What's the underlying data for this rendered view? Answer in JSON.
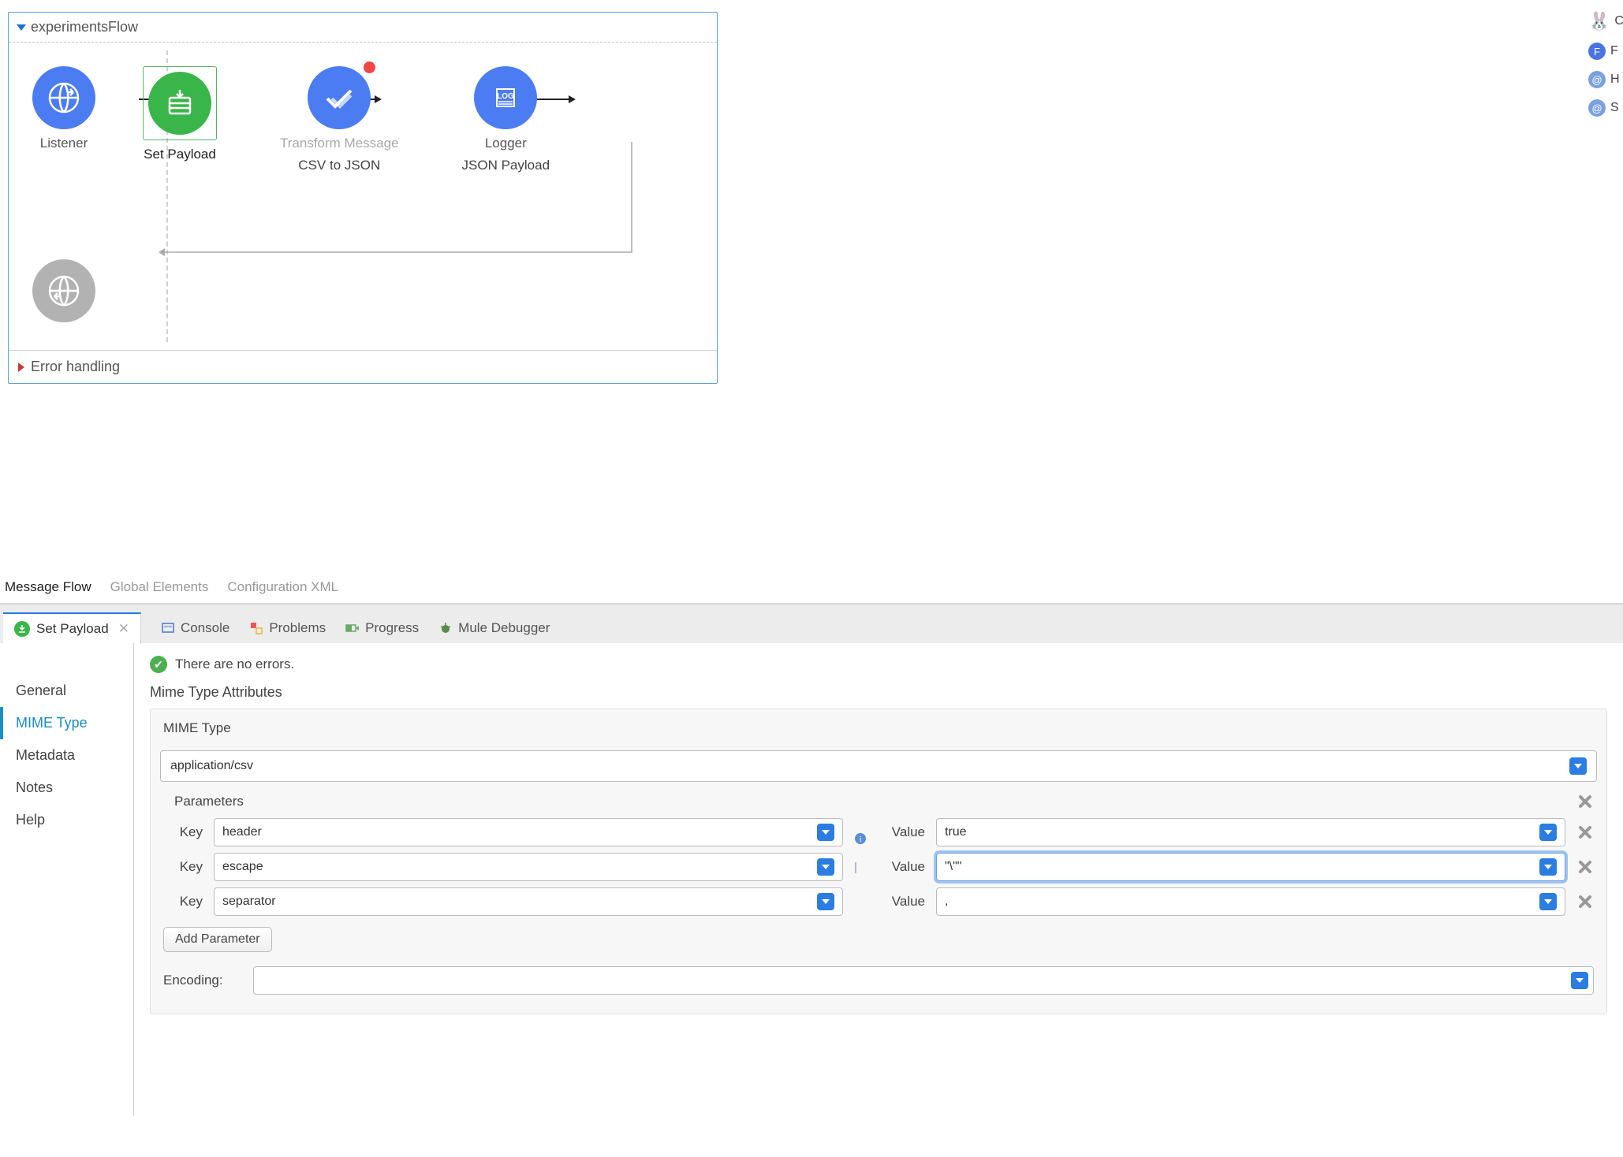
{
  "flow": {
    "title": "experimentsFlow",
    "nodes": {
      "listener": {
        "label": "Listener"
      },
      "setPayload": {
        "label": "Set Payload"
      },
      "transform": {
        "label": "Transform Message",
        "sub": "CSV to JSON"
      },
      "logger": {
        "label": "Logger",
        "sub": "JSON Payload"
      }
    },
    "errorHandling": "Error handling"
  },
  "editorTabs": {
    "messageFlow": "Message Flow",
    "globalElements": "Global Elements",
    "configXml": "Configuration XML"
  },
  "propTabs": {
    "active": "Set Payload",
    "console": "Console",
    "problems": "Problems",
    "progress": "Progress",
    "muleDebugger": "Mule Debugger"
  },
  "sideTabs": {
    "general": "General",
    "mimeType": "MIME Type",
    "metadata": "Metadata",
    "notes": "Notes",
    "help": "Help"
  },
  "status": {
    "message": "There are no errors."
  },
  "panel": {
    "sectionTitle": "Mime Type Attributes",
    "mimeLabel": "MIME Type",
    "mimeValue": "application/csv",
    "parametersLabel": "Parameters",
    "keyLabel": "Key",
    "valueLabel": "Value",
    "parameters": [
      {
        "key": "header",
        "value": "true"
      },
      {
        "key": "escape",
        "value": "\"\\\"\""
      },
      {
        "key": "separator",
        "value": ","
      }
    ],
    "addParameter": "Add Parameter",
    "encodingLabel": "Encoding:",
    "encodingValue": ""
  },
  "rightBar": {
    "items": [
      "C",
      "F",
      "H",
      "S"
    ]
  }
}
